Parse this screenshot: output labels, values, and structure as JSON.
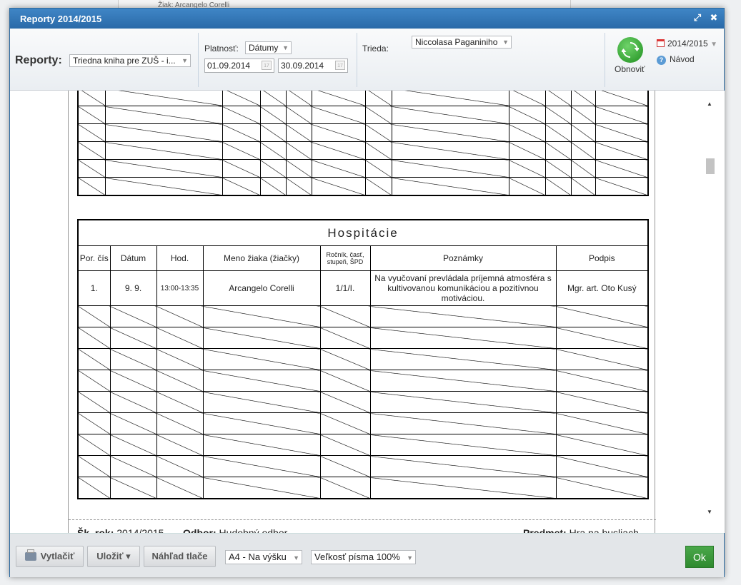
{
  "background": {
    "text": "Žiak: Arcangelo Corelli"
  },
  "dialog": {
    "title": "Reporty 2014/2015"
  },
  "toolbar": {
    "reports_label": "Reporty:",
    "report_select": "Triedna kniha pre ZUŠ - i...",
    "validity_label": "Platnosť:",
    "validity_select": "Dátumy",
    "date_from": "01.09.2014",
    "date_to": "30.09.2014",
    "class_label": "Trieda:",
    "class_select": "Niccolasa Paganiniho",
    "refresh_label": "Obnoviť",
    "year_label": "2014/2015",
    "help_label": "Návod"
  },
  "hospitacie": {
    "title": "Hospitácie",
    "headers": {
      "por": "Por. čís",
      "datum": "Dátum",
      "hod": "Hod.",
      "meno": "Meno žiaka (žiačky)",
      "rocnik": "Ročník, časť, stupeň, ŠPD",
      "poznamky": "Poznámky",
      "podpis": "Podpis"
    },
    "row1": {
      "por": "1.",
      "datum": "9. 9.",
      "hod": "13:00-13:35",
      "meno": "Arcangelo Corelli",
      "rocnik": "1/1/I.",
      "poznamky": "Na vyučovaní prevládala príjemná atmosféra s kultivovanou komunikáciou a pozitívnou motiváciou.",
      "podpis": "Mgr. art. Oto Kusý"
    }
  },
  "footer": {
    "year_label": "Šk. rok:",
    "year_value": "2014/2015",
    "dept_label": "Odbor:",
    "dept_value": "Hudobný odbor",
    "subject_label": "Predmet:",
    "subject_value": "Hra na husliach"
  },
  "bottombar": {
    "print": "Vytlačiť",
    "save": "Uložiť ▾",
    "preview": "Náhľad tlače",
    "paper_select": "A4 - Na výšku",
    "font_select": "Veľkosť písma 100%",
    "ok": "Ok"
  }
}
